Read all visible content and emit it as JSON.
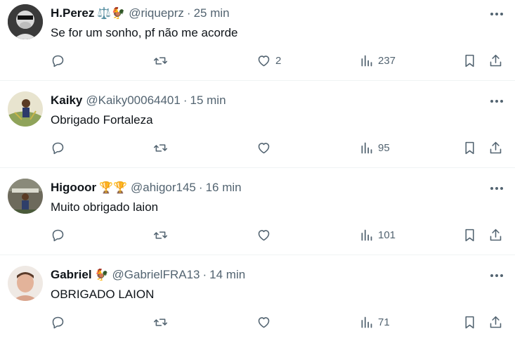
{
  "tweets": [
    {
      "name": "H.Perez",
      "emoji": "⚖️🐓",
      "handle": "@riqueprz",
      "time": "25 min",
      "text": "Se for um sonho, pf não me acorde",
      "likes": "2",
      "views": "237"
    },
    {
      "name": "Kaiky",
      "emoji": "",
      "handle": "@Kaiky00064401",
      "time": "15 min",
      "text": "Obrigado Fortaleza",
      "likes": "",
      "views": "95"
    },
    {
      "name": "Higooor",
      "emoji": "🏆🏆",
      "handle": "@ahigor145",
      "time": "16 min",
      "text": "Muito obrigado laion",
      "likes": "",
      "views": "101"
    },
    {
      "name": "Gabriel",
      "emoji": "🐓",
      "handle": "@GabrielFRA13",
      "time": "14 min",
      "text": "OBRIGADO LAION",
      "likes": "",
      "views": "71"
    }
  ],
  "separator": "·",
  "icons": [
    "more-icon",
    "reply-icon",
    "retweet-icon",
    "like-icon",
    "views-icon",
    "bookmark-icon",
    "share-icon"
  ],
  "colors": {
    "secondary_text": "#536471",
    "primary_text": "#0f1419",
    "divider": "#eff3f4"
  }
}
